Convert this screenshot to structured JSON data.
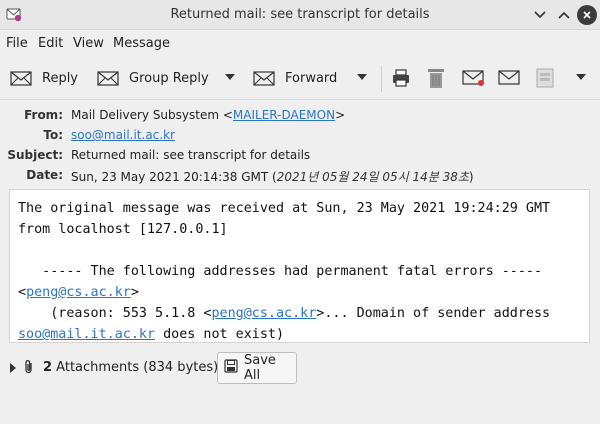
{
  "window": {
    "title": "Returned mail: see transcript for details"
  },
  "menu": [
    "File",
    "Edit",
    "View",
    "Message"
  ],
  "toolbar": {
    "reply_label": "Reply",
    "group_reply_label": "Group Reply",
    "forward_label": "Forward"
  },
  "headers": {
    "from_label": "From:",
    "from_name": "Mail Delivery Subsystem <",
    "from_address": "MAILER-DAEMON",
    "from_suffix": ">",
    "to_label": "To:",
    "to_address": "soo@mail.it.ac.kr",
    "subject_label": "Subject:",
    "subject": "Returned mail: see transcript for details",
    "date_label": "Date:",
    "date": "Sun, 23 May 2021 20:14:38 GMT (",
    "date_local": "2021년 05월 24일 05시 14분 38초",
    "date_suffix": ")"
  },
  "body": {
    "line1": "The original message was received at Sun, 23 May 2021 19:24:29 GMT",
    "line2": "from localhost [127.0.0.1]",
    "line3": "   ----- The following addresses had permanent fatal errors -----",
    "line4_pre": "<",
    "line4_link": "peng@cs.ac.kr",
    "line4_post": ">",
    "line5_pre": "    (reason: 553 5.1.8 <",
    "line5_link": "peng@cs.ac.kr",
    "line5_post": ">... Domain of sender address",
    "line6_link": "soo@mail.it.ac.kr",
    "line6_post": " does not exist)"
  },
  "attachments": {
    "count": "2",
    "label": " Attachments (834 bytes)",
    "save_all_label": "Save All"
  },
  "icons": {
    "app": "mail-app-icon",
    "reply": "reply-icon",
    "group_reply": "group-reply-icon",
    "forward": "forward-icon",
    "print": "print-icon",
    "delete": "trash-icon",
    "mark": "mail-flag-icon",
    "mail_plain": "mail-icon",
    "archive": "archive-icon",
    "attachment": "paperclip-icon",
    "save": "save-icon"
  }
}
